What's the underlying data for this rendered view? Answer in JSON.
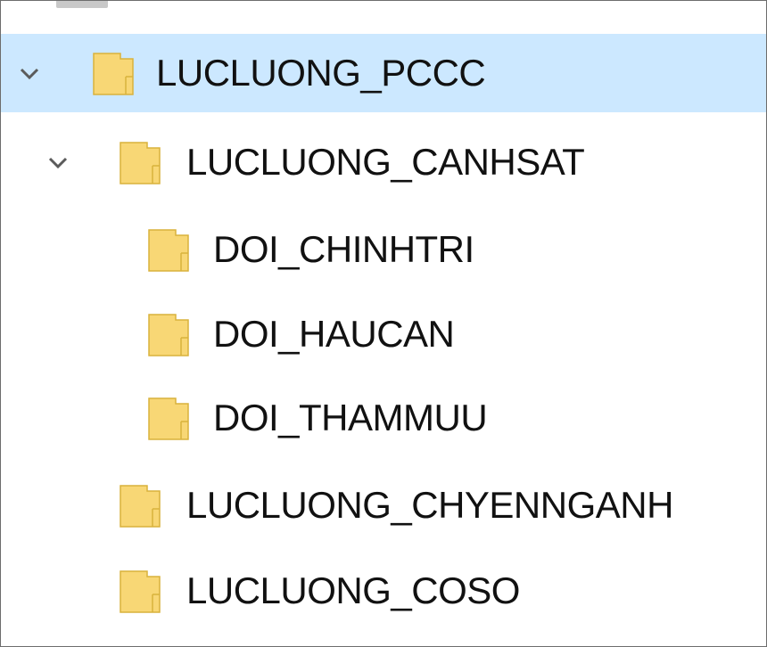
{
  "tree": {
    "root": {
      "label": "LUCLUONG_PCCC",
      "expanded": true,
      "selected": true
    },
    "canhsat": {
      "label": "LUCLUONG_CANHSAT",
      "expanded": true
    },
    "chinhtri": {
      "label": "DOI_CHINHTRI"
    },
    "haucan": {
      "label": "DOI_HAUCAN"
    },
    "thammuu": {
      "label": "DOI_THAMMUU"
    },
    "chyennganh": {
      "label": "LUCLUONG_CHYENNGANH"
    },
    "coso": {
      "label": "LUCLUONG_COSO"
    }
  },
  "colors": {
    "selection": "#cce8ff",
    "folder_body": "#f8d775",
    "folder_outline": "#d9b23c",
    "chevron": "#5b5b5b"
  }
}
